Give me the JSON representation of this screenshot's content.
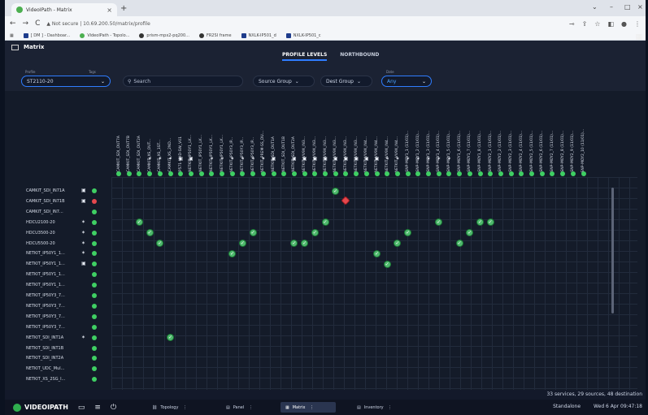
{
  "browser": {
    "tab_title": "VideoIPath - Matrix",
    "address_secure": "Not secure",
    "address_url": "10.69.200.50/matrix/profile",
    "bookmarks": [
      "[ DM ] - Dashboar...",
      "VideoIPath - Topolo...",
      "prism-mpx2-pq200...",
      "FR2SI frame",
      "NXLK-IP501_d",
      "NXLK-IP501_c"
    ]
  },
  "app": {
    "title": "Matrix",
    "tabs": [
      "PROFILE LEVELS",
      "NORTHBOUND"
    ],
    "active_tab": "PROFILE LEVELS"
  },
  "filters": {
    "profile_label": "Profile",
    "tags_label": "Tags",
    "profile_value": "ST2110-20",
    "search_placeholder": "Search",
    "source_group": "Source Group",
    "dest_group": "Dest Group",
    "date_label": "Date",
    "date_value": "Any"
  },
  "columns": [
    "CAMKIT_SDI_OUT7A",
    "CAMKIT_SDI_OUT7B",
    "CAMKIT_SDI_OUT2A",
    "CAMKIT_XS_OUT...",
    "CAMKIT_XS_1ST...",
    "CAMKIT_XS_2ND...",
    "IP571-HHD-SW_V01",
    "NETKIT_IP50Y1_LK...",
    "NETKIT_IP50Y1_LK...",
    "NETKIT_IP50Y1_LK...",
    "NETKIT_IP50Y1_LK...",
    "NETKIT_IP50Y3_IP...",
    "NETKIT_IP50Y3_IP...",
    "NETKIT_IP50Y3_IP...",
    "NETKIT_PREM-SS_DU...",
    "NETKIT_SDI_OUT1A",
    "NETKIT_SDI_OUT1B",
    "NETKIT_SDI_OUT2A",
    "NETKIT_VV9X_IN3...",
    "NETKIT_VV9X_IN3...",
    "NETKIT_VV9X_IN3...",
    "NETKIT_VV9X_IN3...",
    "NETKIT_VV9X_IN3...",
    "NETKIT_VV9X_IN3...",
    "NETKIT_VV9X_IN4...",
    "NETKIT_VV9X_IN4...",
    "NETKIT_VV9X_IN4...",
    "NETKIT_VV9X_IN4...",
    "SNP-MOY1_1 (11/01)...",
    "SNP-MOY1_2 (11/01)...",
    "SNP-MOY1_3 (11/01)...",
    "SNP-MOY1_4 (11/01)...",
    "SNP-MOY1_5 (11/01)...",
    "SNP-MOY1_6 (11/01)...",
    "SNP-MOY1_7 (11/01)...",
    "SNP-MOY1_8 (11/01)...",
    "SNP-MOY2_1 (11/01)...",
    "SNP-MOY2_2 (11/01)...",
    "SNP-MOY2_3 (11/01)...",
    "SNP-MOY2_4 (11/01)...",
    "SNP-MOY2_5 (11/01)...",
    "SNP-MOY2_6 (11/01)...",
    "SNP-MOY2_7 (11/01)...",
    "SNP-MOY2_8 (11/01)...",
    "SNP-MOY2_9 (11/01)...",
    "SNP-MOY2_10 (11/01)..."
  ],
  "column_icons": [
    "",
    "",
    "",
    "run",
    "run",
    "run",
    "lock",
    "lock",
    "",
    "run",
    "run",
    "run",
    "run",
    "run",
    "run",
    "lock",
    "",
    "lock",
    "lock",
    "lock",
    "lock",
    "lock",
    "lock",
    "lock",
    "lock",
    "lock",
    "run",
    "run",
    "run",
    "run",
    "run",
    "run",
    "run",
    "",
    "",
    "",
    "",
    "",
    "",
    "",
    "",
    "",
    "",
    "",
    "",
    ""
  ],
  "rows": [
    {
      "label": "CAMKIT_SDI_IN71A",
      "icon": "lock",
      "status": "green"
    },
    {
      "label": "CAMKIT_SDI_IN71B",
      "icon": "lock",
      "status": "red"
    },
    {
      "label": "CAMKIT_SDI_IN7...",
      "icon": "",
      "status": "green"
    },
    {
      "label": "HDCU2100-20",
      "icon": "run",
      "status": "green"
    },
    {
      "label": "HDCU3500-20",
      "icon": "run",
      "status": "green"
    },
    {
      "label": "HDCU5500-20",
      "icon": "run",
      "status": "green"
    },
    {
      "label": "NETKIT_IP50Y1_1...",
      "icon": "run",
      "status": "green"
    },
    {
      "label": "NETKIT_IP50Y1_1...",
      "icon": "lock",
      "status": "green"
    },
    {
      "label": "NETKIT_IP50Y1_1...",
      "icon": "",
      "status": "green"
    },
    {
      "label": "NETKIT_IP50Y1_1...",
      "icon": "",
      "status": "green"
    },
    {
      "label": "NETKIT_IP50Y3_7...",
      "icon": "",
      "status": "green"
    },
    {
      "label": "NETKIT_IP50Y3_7...",
      "icon": "",
      "status": "green"
    },
    {
      "label": "NETKIT_IP50Y3_7...",
      "icon": "",
      "status": "green"
    },
    {
      "label": "NETKIT_IP50Y3_7...",
      "icon": "",
      "status": "green"
    },
    {
      "label": "NETKIT_SDI_INT1A",
      "icon": "run",
      "status": "green"
    },
    {
      "label": "NETKIT_SDI_INT1B",
      "icon": "",
      "status": "green"
    },
    {
      "label": "NETKIT_SDI_INT2A",
      "icon": "",
      "status": "green"
    },
    {
      "label": "NETKIT_UDC_Mul...",
      "icon": "",
      "status": "green"
    },
    {
      "label": "NETKIT_XS_2SG_I...",
      "icon": "",
      "status": "green"
    }
  ],
  "connections": [
    {
      "row": 0,
      "col": 21,
      "state": "ok"
    },
    {
      "row": 1,
      "col": 22,
      "state": "error"
    },
    {
      "row": 3,
      "col": 2,
      "state": "ok"
    },
    {
      "row": 3,
      "col": 20,
      "state": "ok"
    },
    {
      "row": 3,
      "col": 31,
      "state": "ok"
    },
    {
      "row": 3,
      "col": 35,
      "state": "ok"
    },
    {
      "row": 3,
      "col": 36,
      "state": "ok"
    },
    {
      "row": 4,
      "col": 3,
      "state": "ok"
    },
    {
      "row": 4,
      "col": 13,
      "state": "ok"
    },
    {
      "row": 4,
      "col": 19,
      "state": "ok"
    },
    {
      "row": 4,
      "col": 28,
      "state": "ok"
    },
    {
      "row": 4,
      "col": 34,
      "state": "ok"
    },
    {
      "row": 5,
      "col": 4,
      "state": "ok"
    },
    {
      "row": 5,
      "col": 12,
      "state": "ok"
    },
    {
      "row": 5,
      "col": 17,
      "state": "ok"
    },
    {
      "row": 5,
      "col": 18,
      "state": "ok"
    },
    {
      "row": 5,
      "col": 27,
      "state": "ok"
    },
    {
      "row": 5,
      "col": 33,
      "state": "ok"
    },
    {
      "row": 6,
      "col": 11,
      "state": "ok"
    },
    {
      "row": 6,
      "col": 25,
      "state": "ok"
    },
    {
      "row": 7,
      "col": 26,
      "state": "ok"
    },
    {
      "row": 14,
      "col": 5,
      "state": "ok"
    }
  ],
  "status_text": "33 services, 29 sources, 48 destination",
  "taskbar": {
    "logo": "VIDEOIPATH",
    "tabs": [
      "Topology",
      "Panel",
      "Matrix",
      "Inventory"
    ],
    "active_tab": "Matrix",
    "mode": "Standalone",
    "datetime": "Wed 6 Apr  09:47:18"
  }
}
